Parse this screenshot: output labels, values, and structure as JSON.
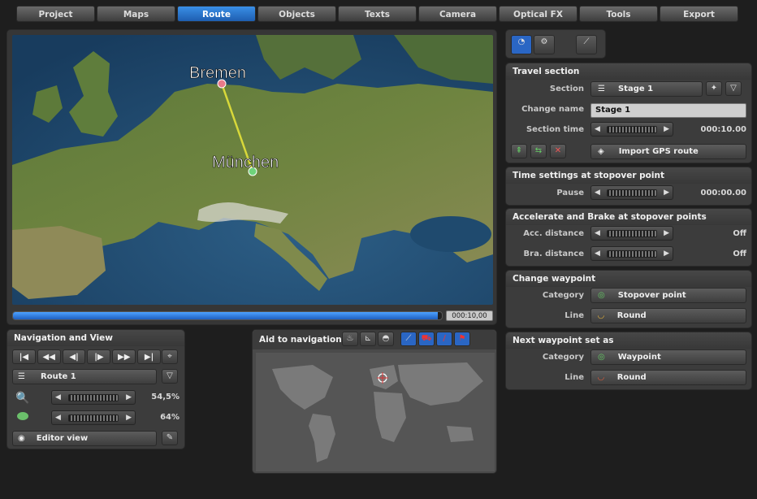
{
  "tabs": [
    "Project",
    "Maps",
    "Route",
    "Objects",
    "Texts",
    "Camera",
    "Optical FX",
    "Tools",
    "Export"
  ],
  "active_tab": "Route",
  "map": {
    "city1": "Bremen",
    "city2": "München",
    "time": "000:10,00",
    "progress": 0.99
  },
  "nav": {
    "title": "Navigation and View",
    "route": "Route 1",
    "zoom": "54,5%",
    "tilt": "64%",
    "view": "Editor view"
  },
  "aid": {
    "title": "Aid to navigation"
  },
  "travel": {
    "title": "Travel section",
    "section_label": "Section",
    "section_value": "Stage 1",
    "change_name_label": "Change name",
    "change_name_value": "Stage 1",
    "section_time_label": "Section time",
    "section_time_value": "000:10.00",
    "import": "Import GPS route"
  },
  "time_settings": {
    "title": "Time settings at stopover point",
    "pause_label": "Pause",
    "pause_value": "000:00.00"
  },
  "accel": {
    "title": "Accelerate and Brake at stopover points",
    "acc_label": "Acc. distance",
    "acc_value": "Off",
    "bra_label": "Bra. distance",
    "bra_value": "Off"
  },
  "change_wp": {
    "title": "Change waypoint",
    "category_label": "Category",
    "category_value": "Stopover point",
    "line_label": "Line",
    "line_value": "Round"
  },
  "next_wp": {
    "title": "Next waypoint set as",
    "category_label": "Category",
    "category_value": "Waypoint",
    "line_label": "Line",
    "line_value": "Round"
  }
}
